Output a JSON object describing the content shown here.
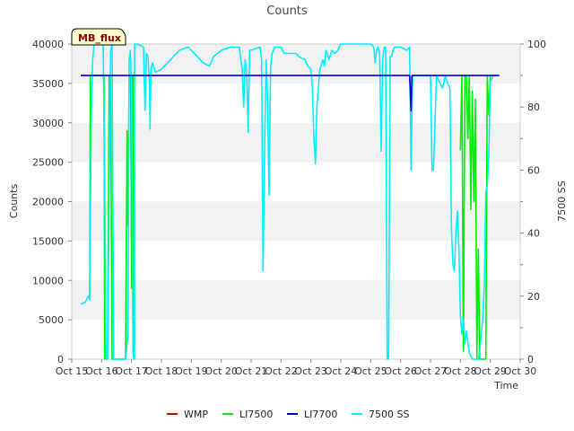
{
  "chart_data": {
    "type": "line",
    "title": "Counts",
    "xlabel": "Time",
    "ylabel": "Counts",
    "y2label": "7500 SS",
    "badge": "MB_flux",
    "xlim": [
      15,
      30
    ],
    "ylim": [
      0,
      40000
    ],
    "y2lim": [
      0,
      100
    ],
    "x_ticks": [
      {
        "v": 15,
        "label": "Oct 15"
      },
      {
        "v": 16,
        "label": "Oct 16"
      },
      {
        "v": 17,
        "label": "Oct 17"
      },
      {
        "v": 18,
        "label": "Oct 18"
      },
      {
        "v": 19,
        "label": "Oct 19"
      },
      {
        "v": 20,
        "label": "Oct 20"
      },
      {
        "v": 21,
        "label": "Oct 21"
      },
      {
        "v": 22,
        "label": "Oct 22"
      },
      {
        "v": 23,
        "label": "Oct 23"
      },
      {
        "v": 24,
        "label": "Oct 24"
      },
      {
        "v": 25,
        "label": "Oct 25"
      },
      {
        "v": 26,
        "label": "Oct 26"
      },
      {
        "v": 27,
        "label": "Oct 27"
      },
      {
        "v": 28,
        "label": "Oct 28"
      },
      {
        "v": 29,
        "label": "Oct 29"
      },
      {
        "v": 30,
        "label": "Oct 30"
      }
    ],
    "y_ticks": [
      {
        "v": 0,
        "label": "0"
      },
      {
        "v": 5000,
        "label": "5000"
      },
      {
        "v": 10000,
        "label": "10000"
      },
      {
        "v": 15000,
        "label": "15000"
      },
      {
        "v": 20000,
        "label": "20000"
      },
      {
        "v": 25000,
        "label": "25000"
      },
      {
        "v": 30000,
        "label": "30000"
      },
      {
        "v": 35000,
        "label": "35000"
      },
      {
        "v": 40000,
        "label": "40000"
      }
    ],
    "y2_ticks": [
      {
        "v": 0,
        "label": "0"
      },
      {
        "v": 20,
        "label": "20"
      },
      {
        "v": 40,
        "label": "40"
      },
      {
        "v": 60,
        "label": "60"
      },
      {
        "v": 80,
        "label": "80"
      },
      {
        "v": 100,
        "label": "100"
      }
    ],
    "grid_bands": true,
    "legend_position": "bottom-center",
    "series": [
      {
        "name": "WMP",
        "color": "#cc0000",
        "axis": "left",
        "points": []
      },
      {
        "name": "LI7500",
        "color": "#00ee00",
        "axis": "left",
        "points": [
          [
            15.6,
            7500
          ],
          [
            15.62,
            36000
          ],
          [
            15.66,
            36000
          ],
          [
            15.7,
            36000
          ],
          [
            15.8,
            36000
          ],
          [
            15.9,
            36000
          ],
          [
            16.0,
            36000
          ],
          [
            16.05,
            36000
          ],
          [
            16.08,
            36000
          ],
          [
            16.1,
            0
          ],
          [
            16.2,
            0
          ],
          [
            16.25,
            36000
          ],
          [
            16.3,
            36000
          ],
          [
            16.35,
            0
          ],
          [
            16.5,
            0
          ],
          [
            16.8,
            0
          ],
          [
            16.85,
            29000
          ],
          [
            16.88,
            17000
          ],
          [
            16.92,
            36000
          ],
          [
            16.97,
            36000
          ],
          [
            17.0,
            9000
          ],
          [
            17.02,
            36000
          ],
          [
            17.05,
            36000
          ],
          [
            17.08,
            0
          ],
          [
            17.1,
            0
          ]
        ]
      },
      {
        "name": "LI7700",
        "color": "#0000cc",
        "axis": "left",
        "points": [
          [
            15.3,
            36000
          ],
          [
            26.3,
            36000
          ],
          [
            26.35,
            31500
          ],
          [
            26.38,
            36000
          ],
          [
            29.3,
            36000
          ]
        ]
      },
      {
        "name": "7500 SS",
        "color": "#00eeff",
        "axis": "right",
        "points": [
          [
            15.3,
            17.5
          ],
          [
            15.45,
            18
          ],
          [
            15.5,
            19
          ],
          [
            15.55,
            20
          ],
          [
            15.6,
            19
          ],
          [
            15.65,
            75
          ],
          [
            15.7,
            95
          ],
          [
            15.75,
            100
          ],
          [
            15.8,
            100
          ],
          [
            15.9,
            100
          ],
          [
            16.0,
            100
          ],
          [
            16.05,
            100
          ],
          [
            16.1,
            60
          ],
          [
            16.15,
            0
          ],
          [
            16.2,
            0
          ],
          [
            16.3,
            98
          ],
          [
            16.35,
            100
          ],
          [
            16.4,
            0
          ],
          [
            16.5,
            0
          ],
          [
            16.6,
            0
          ],
          [
            16.7,
            0
          ],
          [
            16.75,
            0
          ],
          [
            16.8,
            0
          ],
          [
            16.85,
            5
          ],
          [
            16.88,
            7
          ],
          [
            16.92,
            95
          ],
          [
            16.96,
            98
          ],
          [
            17.0,
            85
          ],
          [
            17.05,
            2
          ],
          [
            17.08,
            0
          ],
          [
            17.1,
            0
          ],
          [
            17.1,
            100
          ],
          [
            17.2,
            100
          ],
          [
            17.4,
            99
          ],
          [
            17.45,
            79
          ],
          [
            17.5,
            97
          ],
          [
            17.55,
            96
          ],
          [
            17.6,
            87
          ],
          [
            17.62,
            73
          ],
          [
            17.65,
            92
          ],
          [
            17.7,
            94
          ],
          [
            17.8,
            91
          ],
          [
            18.0,
            92
          ],
          [
            18.3,
            95
          ],
          [
            18.6,
            98
          ],
          [
            18.9,
            99
          ],
          [
            19.1,
            97
          ],
          [
            19.3,
            95
          ],
          [
            19.4,
            94
          ],
          [
            19.6,
            93
          ],
          [
            19.75,
            96
          ],
          [
            20.0,
            98
          ],
          [
            20.3,
            99
          ],
          [
            20.5,
            99
          ],
          [
            20.6,
            99
          ],
          [
            20.7,
            92
          ],
          [
            20.75,
            80
          ],
          [
            20.8,
            95
          ],
          [
            20.85,
            92
          ],
          [
            20.9,
            72
          ],
          [
            20.95,
            98
          ],
          [
            21.0,
            98
          ],
          [
            21.3,
            99
          ],
          [
            21.35,
            95
          ],
          [
            21.4,
            28
          ],
          [
            21.45,
            65
          ],
          [
            21.5,
            95
          ],
          [
            21.55,
            83
          ],
          [
            21.6,
            52
          ],
          [
            21.65,
            92
          ],
          [
            21.7,
            97
          ],
          [
            21.8,
            99
          ],
          [
            22.0,
            99
          ],
          [
            22.1,
            97
          ],
          [
            22.3,
            97
          ],
          [
            22.4,
            97
          ],
          [
            22.5,
            97
          ],
          [
            22.6,
            96
          ],
          [
            22.8,
            95
          ],
          [
            22.9,
            93
          ],
          [
            23.0,
            92
          ],
          [
            23.05,
            86
          ],
          [
            23.1,
            70
          ],
          [
            23.15,
            62
          ],
          [
            23.2,
            80
          ],
          [
            23.3,
            92
          ],
          [
            23.4,
            95
          ],
          [
            23.45,
            93
          ],
          [
            23.5,
            98
          ],
          [
            23.55,
            97
          ],
          [
            23.6,
            95
          ],
          [
            23.7,
            98
          ],
          [
            23.8,
            97
          ],
          [
            23.9,
            98
          ],
          [
            24.0,
            100
          ],
          [
            24.2,
            100
          ],
          [
            24.4,
            100
          ],
          [
            24.6,
            100
          ],
          [
            24.8,
            100
          ],
          [
            25.0,
            100
          ],
          [
            25.1,
            99
          ],
          [
            25.15,
            94
          ],
          [
            25.2,
            98
          ],
          [
            25.25,
            99
          ],
          [
            25.3,
            97
          ],
          [
            25.35,
            66
          ],
          [
            25.4,
            95
          ],
          [
            25.45,
            99
          ],
          [
            25.5,
            99
          ],
          [
            25.55,
            0
          ],
          [
            25.6,
            0
          ],
          [
            25.65,
            96
          ],
          [
            25.7,
            96
          ],
          [
            25.75,
            98
          ],
          [
            25.8,
            99
          ],
          [
            26.0,
            99
          ],
          [
            26.2,
            98
          ],
          [
            26.3,
            99
          ],
          [
            26.35,
            60
          ],
          [
            26.4,
            90
          ],
          [
            26.5,
            90
          ],
          [
            26.7,
            90
          ],
          [
            26.8,
            90
          ],
          [
            26.85,
            90
          ],
          [
            26.9,
            90
          ],
          [
            27.0,
            90
          ],
          [
            27.05,
            60
          ],
          [
            27.1,
            60
          ],
          [
            27.15,
            75
          ],
          [
            27.2,
            90
          ],
          [
            27.3,
            88
          ],
          [
            27.4,
            86
          ],
          [
            27.5,
            90
          ],
          [
            27.55,
            88
          ],
          [
            27.6,
            87
          ],
          [
            27.65,
            86
          ],
          [
            27.7,
            42
          ],
          [
            27.75,
            30
          ],
          [
            27.8,
            28
          ],
          [
            27.85,
            40
          ],
          [
            27.9,
            47
          ],
          [
            27.95,
            35
          ],
          [
            28.0,
            14
          ],
          [
            28.05,
            8
          ],
          [
            28.1,
            13
          ],
          [
            28.15,
            5
          ],
          [
            28.2,
            9
          ],
          [
            28.3,
            2
          ],
          [
            28.4,
            0
          ],
          [
            28.5,
            0
          ],
          [
            28.6,
            0
          ],
          [
            28.65,
            3
          ],
          [
            28.7,
            8
          ],
          [
            28.75,
            13
          ],
          [
            28.8,
            23
          ],
          [
            28.85,
            53
          ],
          [
            28.9,
            55
          ],
          [
            28.95,
            65
          ],
          [
            29.0,
            88
          ],
          [
            29.05,
            89
          ],
          [
            29.1,
            90
          ],
          [
            29.2,
            90
          ]
        ]
      }
    ],
    "li7500_late_points": [
      [
        28.0,
        26500
      ],
      [
        28.05,
        36000
      ],
      [
        28.1,
        1000
      ],
      [
        28.15,
        36000
      ],
      [
        28.2,
        36000
      ],
      [
        28.25,
        28000
      ],
      [
        28.3,
        36000
      ],
      [
        28.35,
        19000
      ],
      [
        28.4,
        34000
      ],
      [
        28.45,
        20000
      ],
      [
        28.5,
        33000
      ],
      [
        28.55,
        0
      ],
      [
        28.6,
        14000
      ],
      [
        28.65,
        0
      ],
      [
        28.7,
        0
      ],
      [
        28.75,
        0
      ],
      [
        28.8,
        0
      ],
      [
        28.85,
        0
      ],
      [
        28.9,
        36000
      ],
      [
        28.95,
        31000
      ],
      [
        29.0,
        36000
      ],
      [
        29.05,
        36000
      ]
    ]
  }
}
